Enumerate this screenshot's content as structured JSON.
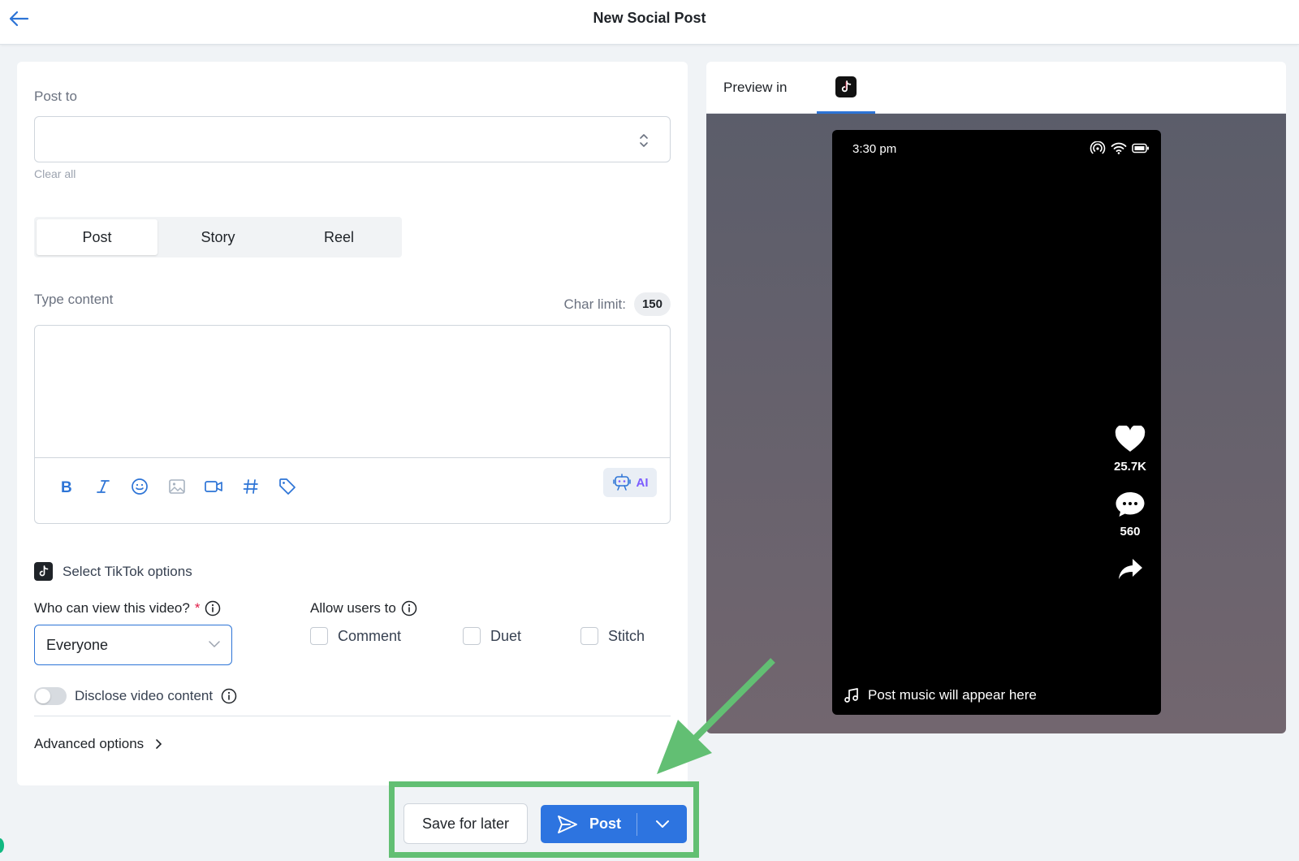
{
  "header": {
    "title": "New Social Post"
  },
  "form": {
    "post_to_label": "Post to",
    "post_to_value": "",
    "clear_all": "Clear all",
    "post_types": [
      "Post",
      "Story",
      "Reel"
    ],
    "active_post_type": "Post",
    "content_label": "Type content",
    "char_limit_label": "Char limit:",
    "char_limit_value": "150",
    "content_value": "",
    "ai_label": "AI",
    "tiktok_options_label": "Select TikTok options",
    "who_can_view_label": "Who can view this video?",
    "who_can_view_required": "*",
    "who_can_view_value": "Everyone",
    "allow_users_label": "Allow users to",
    "allow_options": [
      "Comment",
      "Duet",
      "Stitch"
    ],
    "disclose_label": "Disclose video content",
    "disclose_enabled": false,
    "advanced_label": "Advanced options"
  },
  "preview": {
    "label": "Preview in",
    "platform_icon": "tiktok-icon",
    "phone": {
      "time": "3:30 pm",
      "likes": "25.7K",
      "comments": "560",
      "music_text": "Post music will appear here"
    }
  },
  "actions": {
    "save_label": "Save for later",
    "post_label": "Post"
  },
  "colors": {
    "primary": "#2d74e0",
    "highlight": "#62bf73",
    "ai_accent": "#7c5cff"
  }
}
